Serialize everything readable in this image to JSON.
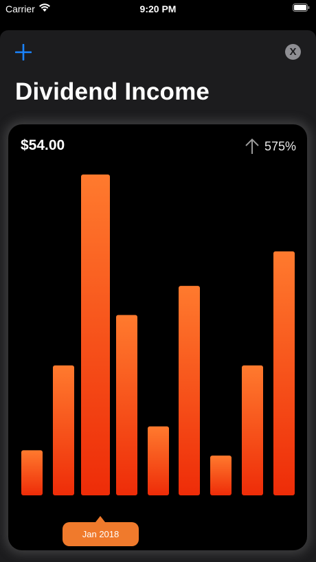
{
  "status_bar": {
    "carrier": "Carrier",
    "time": "9:20 PM"
  },
  "header": {
    "title": "Dividend Income",
    "add_icon": "plus-icon",
    "close_label": "X"
  },
  "card": {
    "amount": "$54.00",
    "change": "575%",
    "change_icon": "arrow-up-icon",
    "selected_label": "Jan 2018"
  },
  "colors": {
    "accent_blue": "#1a84ff",
    "bar_top": "#ff7a2e",
    "bar_bottom": "#ee2c08",
    "badge": "#f07a2c"
  },
  "chart_data": {
    "type": "bar",
    "values": [
      1.7,
      4.9,
      12.1,
      6.8,
      2.6,
      7.9,
      1.5,
      4.9,
      9.2
    ],
    "ylim": [
      0,
      12.1
    ],
    "selected_index": 2
  }
}
